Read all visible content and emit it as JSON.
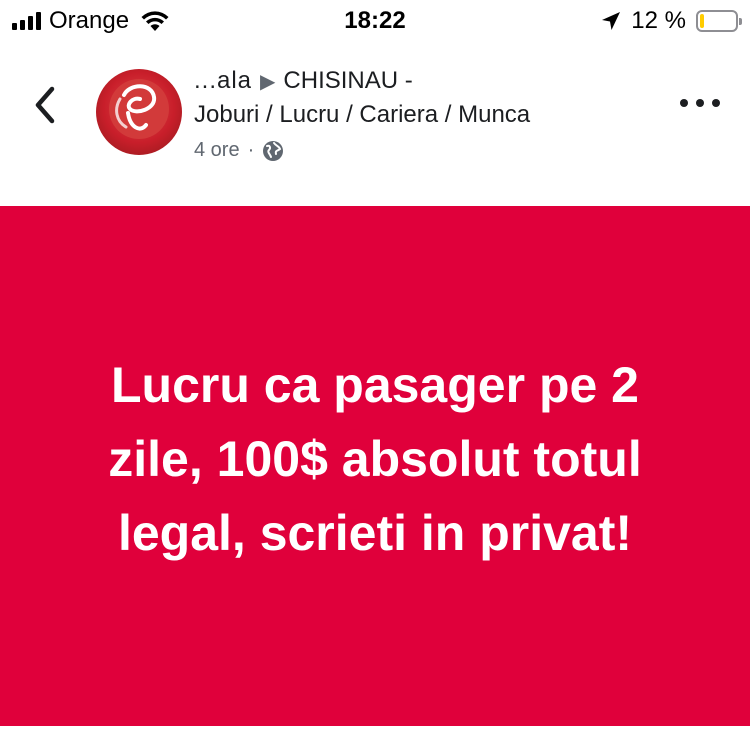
{
  "status_bar": {
    "carrier": "Orange",
    "time": "18:22",
    "battery_percent": "12 %",
    "battery_level": 0.12,
    "battery_color": "#ffcc00"
  },
  "post": {
    "author_partial": "...ala",
    "group_line1": "CHISINAU -",
    "group_line2": "Joburi / Lucru / Cariera / Munca",
    "time_ago": "4 ore",
    "separator": "·",
    "privacy_icon": "globe-icon",
    "banner_color": "#e0003b",
    "banner_text": "Lucru ca pasager pe 2 zile, 100$ absolut totul legal, scrieti in privat!"
  },
  "icons": {
    "back": "chevron-left-icon",
    "more": "more-dots-icon",
    "location": "location-arrow-icon",
    "wifi": "wifi-icon",
    "signal": "signal-bars-icon"
  }
}
